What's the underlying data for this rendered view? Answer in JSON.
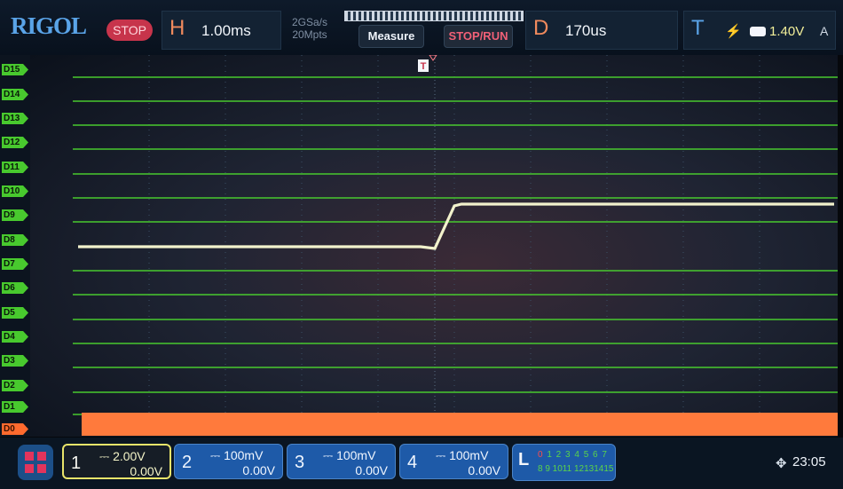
{
  "brand": {
    "name": "RIGOL"
  },
  "status": {
    "run_state": "STOP"
  },
  "horizontal": {
    "letter": "H",
    "timebase": "1.00ms",
    "sample_rate": "2GSa/s",
    "memory_depth": "20Mpts"
  },
  "toolbar": {
    "measure_label": "Measure",
    "stoprun_label": "STOP/RUN"
  },
  "delay": {
    "letter": "D",
    "value": "170us"
  },
  "trigger": {
    "letter": "T",
    "level": "1.40V",
    "mode": "A",
    "edge_icon": "rising-edge-icon",
    "marker": "T"
  },
  "digital_channels": [
    "D15",
    "D14",
    "D13",
    "D12",
    "D11",
    "D10",
    "D9",
    "D8",
    "D7",
    "D6",
    "D5",
    "D4",
    "D3",
    "D2",
    "D1",
    "D0"
  ],
  "channels": [
    {
      "num": "1",
      "scale": "2.00V",
      "offset": "0.00V",
      "coupling_icon": "dc-coupling-icon",
      "color": "#e8e46a"
    },
    {
      "num": "2",
      "scale": "100mV",
      "offset": "0.00V",
      "coupling_icon": "dc-coupling-icon"
    },
    {
      "num": "3",
      "scale": "100mV",
      "offset": "0.00V",
      "coupling_icon": "dc-coupling-icon"
    },
    {
      "num": "4",
      "scale": "100mV",
      "offset": "0.00V",
      "coupling_icon": "dc-coupling-icon"
    }
  ],
  "la": {
    "letter": "L",
    "row1_first": "0",
    "row1_rest": " 1 2 3  4 5 6 7",
    "row2": "8 9 1011 12131415"
  },
  "system": {
    "time": "23:05",
    "icon": "usb-icon"
  },
  "colors": {
    "digital": "#48c92e",
    "d0": "#ff6a2e",
    "ch1": "#e8e46a",
    "brand": "#5aa4e8",
    "stop": "#c7344b"
  }
}
